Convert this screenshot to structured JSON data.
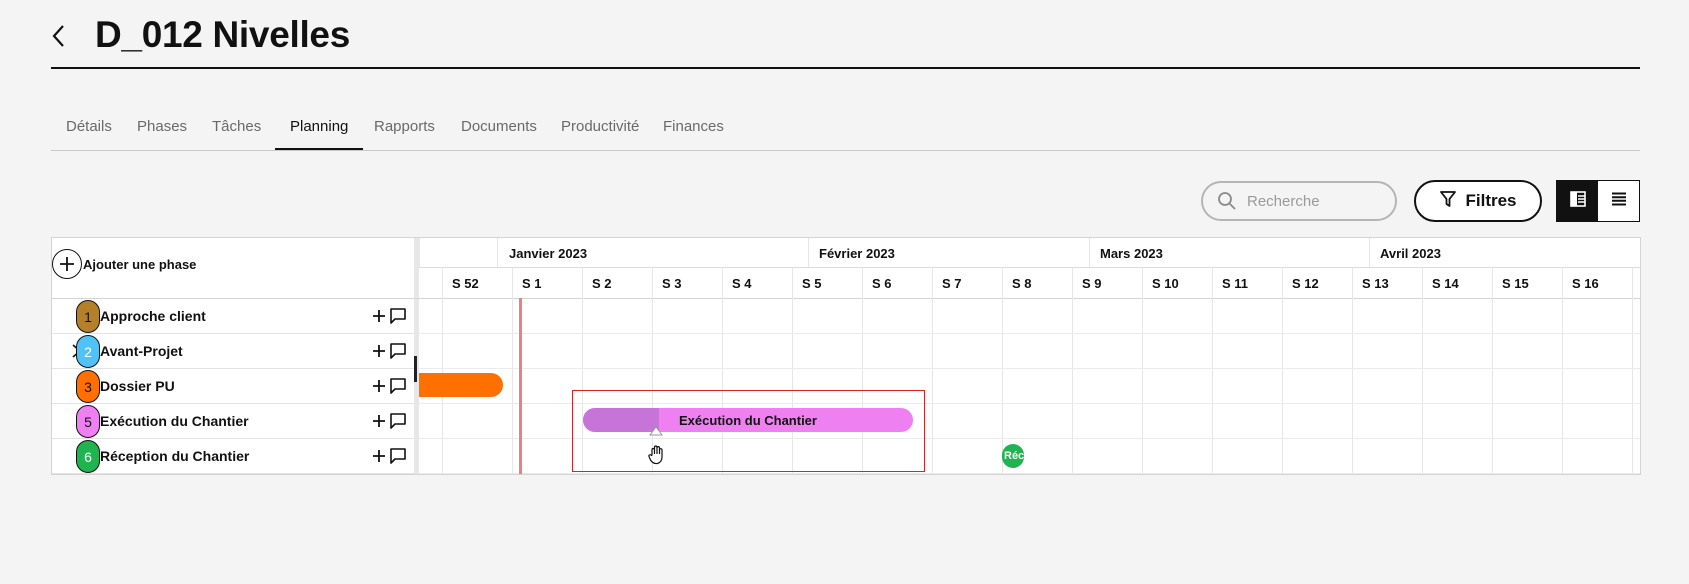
{
  "page": {
    "title": "D_012 Nivelles"
  },
  "tabs": [
    {
      "label": "Détails"
    },
    {
      "label": "Phases"
    },
    {
      "label": "Tâches"
    },
    {
      "label": "Planning",
      "active": true
    },
    {
      "label": "Rapports"
    },
    {
      "label": "Documents"
    },
    {
      "label": "Productivité"
    },
    {
      "label": "Finances"
    }
  ],
  "toolbar": {
    "search_placeholder": "Recherche",
    "search_value": "",
    "filters_label": "Filtres",
    "view_mode": "split"
  },
  "gantt": {
    "add_phase_label": "Ajouter une phase",
    "months": [
      "Janvier 2023",
      "Février 2023",
      "Mars 2023",
      "Avril 2023"
    ],
    "weeks": [
      "S 52",
      "S 1",
      "S 2",
      "S 3",
      "S 4",
      "S 5",
      "S 6",
      "S 7",
      "S 8",
      "S 9",
      "S 10",
      "S 11",
      "S 12",
      "S 13",
      "S 14",
      "S 15",
      "S 16"
    ],
    "phases": [
      {
        "number": "1",
        "name": "Approche client",
        "color": "#b5802a"
      },
      {
        "number": "2",
        "name": "Avant-Projet",
        "color": "#4fc3f7"
      },
      {
        "number": "3",
        "name": "Dossier PU",
        "color": "#ff7000"
      },
      {
        "number": "5",
        "name": "Exécution du Chantier",
        "color": "#ef80f2"
      },
      {
        "number": "6",
        "name": "Réception du Chantier",
        "color": "#1fb44f"
      }
    ],
    "bars": {
      "execution_label": "Exécution du Chantier",
      "execution_progress": 0.23,
      "reception_label": "Réc"
    },
    "colors": {
      "today_line": "#ef7e7e",
      "selection": "#dd2222"
    }
  }
}
